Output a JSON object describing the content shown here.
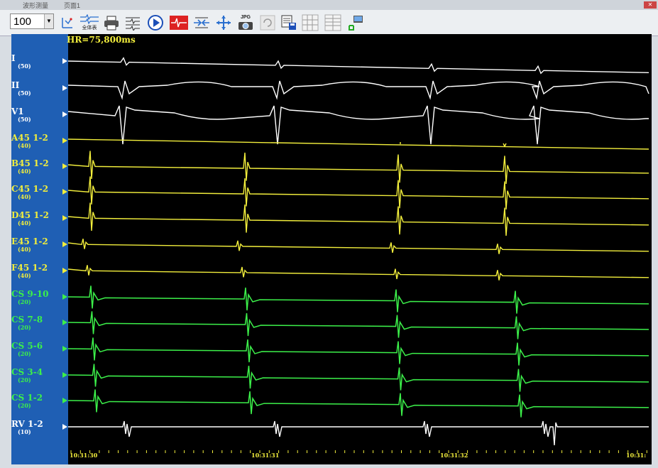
{
  "menubar": {
    "items": [
      "波形测量",
      "页面1"
    ]
  },
  "toolbar": {
    "zoom_value": "100",
    "jpg_label": "JPG",
    "fullbody_label": "全体表"
  },
  "display": {
    "heart_rate": "HR=75,800ms",
    "channels": [
      {
        "name": "I",
        "gain": "(50)",
        "color": "w"
      },
      {
        "name": "II",
        "gain": "(50)",
        "color": "w"
      },
      {
        "name": "V1",
        "gain": "(50)",
        "color": "w"
      },
      {
        "name": "A45 1-2",
        "gain": "(40)",
        "color": "y"
      },
      {
        "name": "B45 1-2",
        "gain": "(40)",
        "color": "y"
      },
      {
        "name": "C45 1-2",
        "gain": "(40)",
        "color": "y"
      },
      {
        "name": "D45 1-2",
        "gain": "(40)",
        "color": "y"
      },
      {
        "name": "E45 1-2",
        "gain": "(40)",
        "color": "y"
      },
      {
        "name": "F45 1-2",
        "gain": "(40)",
        "color": "y"
      },
      {
        "name": "CS 9-10",
        "gain": "(20)",
        "color": "g"
      },
      {
        "name": "CS 7-8",
        "gain": "(20)",
        "color": "g"
      },
      {
        "name": "CS 5-6",
        "gain": "(20)",
        "color": "g"
      },
      {
        "name": "CS 3-4",
        "gain": "(20)",
        "color": "g"
      },
      {
        "name": "CS 1-2",
        "gain": "(20)",
        "color": "g"
      },
      {
        "name": "RV 1-2",
        "gain": "(10)",
        "color": "w"
      }
    ],
    "time_labels": [
      "10:31:30",
      "10:31:31",
      "10:31:32",
      "10:31:"
    ],
    "colors": {
      "white": "#ffffff",
      "yellow": "#f2ee3c",
      "green": "#3cf04a",
      "sidebar": "#1f5fb4"
    }
  }
}
